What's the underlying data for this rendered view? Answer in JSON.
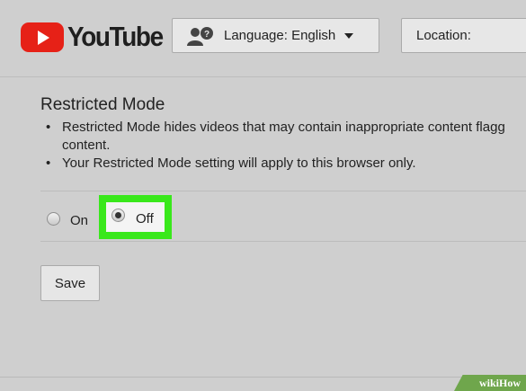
{
  "header": {
    "logo_text": "YouTube",
    "language_button": {
      "label": "Language: English",
      "icon": "people-question-icon"
    },
    "location_button": {
      "label": "Location:"
    }
  },
  "restricted_mode": {
    "title": "Restricted Mode",
    "bullets": [
      {
        "line1": "Restricted Mode hides videos that may contain inappropriate content flagg",
        "line2": "content."
      },
      {
        "line1": "Your Restricted Mode setting will apply to this browser only."
      }
    ],
    "options": [
      {
        "label": "On",
        "selected": false
      },
      {
        "label": "Off",
        "selected": true
      }
    ],
    "highlight_color": "#39e81b",
    "save_label": "Save"
  },
  "watermark": {
    "text": "wikiHow",
    "color": "#6fa64c"
  }
}
